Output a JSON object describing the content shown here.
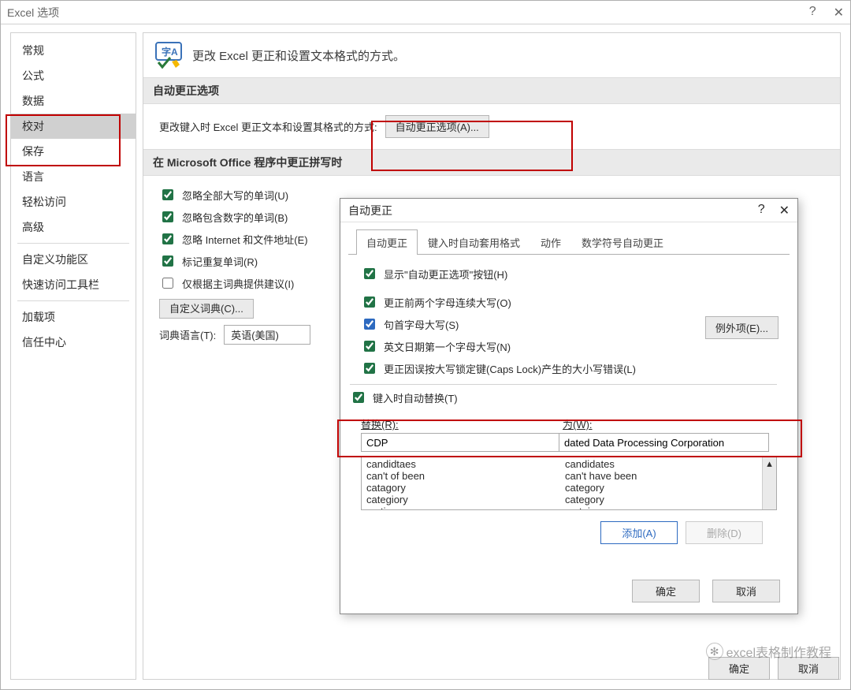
{
  "window": {
    "title": "Excel 选项"
  },
  "sidebar": {
    "items": [
      {
        "label": "常规"
      },
      {
        "label": "公式"
      },
      {
        "label": "数据"
      },
      {
        "label": "校对",
        "selected": true
      },
      {
        "label": "保存"
      },
      {
        "label": "语言"
      },
      {
        "label": "轻松访问"
      },
      {
        "label": "高级"
      },
      {
        "label": "自定义功能区",
        "sep_before": true
      },
      {
        "label": "快速访问工具栏"
      },
      {
        "label": "加载项",
        "sep_before": true
      },
      {
        "label": "信任中心"
      }
    ]
  },
  "main": {
    "title": "更改 Excel 更正和设置文本格式的方式。",
    "section_autocorrect": {
      "head": "自动更正选项",
      "desc": "更改键入时 Excel 更正文本和设置其格式的方式:",
      "button": "自动更正选项(A)..."
    },
    "section_spell": {
      "head": "在 Microsoft Office 程序中更正拼写时",
      "checks": [
        {
          "label": "忽略全部大写的单词(U)",
          "checked": true
        },
        {
          "label": "忽略包含数字的单词(B)",
          "checked": true
        },
        {
          "label": "忽略 Internet 和文件地址(E)",
          "checked": true
        },
        {
          "label": "标记重复单词(R)",
          "checked": true
        },
        {
          "label": "仅根据主词典提供建议(I)",
          "checked": false
        }
      ],
      "dict_btn": "自定义词典(C)...",
      "dict_lang_label": "词典语言(T):",
      "dict_lang_value": "英语(美国)"
    }
  },
  "dialog": {
    "title": "自动更正",
    "tabs": [
      "自动更正",
      "键入时自动套用格式",
      "动作",
      "数学符号自动更正"
    ],
    "show_btn": "显示\"自动更正选项\"按钮(H)",
    "checks": [
      {
        "label": "更正前两个字母连续大写(O)",
        "checked": true,
        "blue": false
      },
      {
        "label": "句首字母大写(S)",
        "checked": true,
        "blue": true
      },
      {
        "label": "英文日期第一个字母大写(N)",
        "checked": true,
        "blue": false
      },
      {
        "label": "更正因误按大写锁定键(Caps Lock)产生的大小写错误(L)",
        "checked": true,
        "blue": false
      }
    ],
    "exceptions_btn": "例外项(E)...",
    "replace_as_type": "键入时自动替换(T)",
    "replace_label": "替换(R):",
    "with_label": "为(W):",
    "replace_value": "CDP",
    "with_value": "dated Data Processing Corporation",
    "list_left": [
      "candidtaes",
      "can't of been",
      "catagory",
      "categiory",
      "certian"
    ],
    "list_right": [
      "candidates",
      "can't have been",
      "category",
      "category",
      "certain"
    ],
    "add_btn": "添加(A)",
    "del_btn": "删除(D)",
    "ok": "确定",
    "cancel": "取消"
  },
  "footer": {
    "ok": "确定",
    "cancel": "取消"
  },
  "watermark": "excel表格制作教程"
}
